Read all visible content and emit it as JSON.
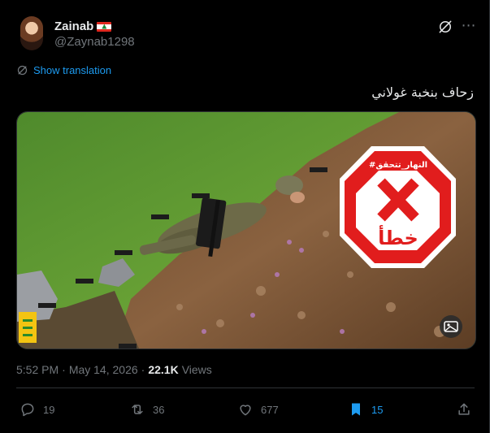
{
  "author": {
    "name": "Zainab",
    "handle": "@Zaynab1298",
    "flag_icon": "lebanon-flag-icon"
  },
  "translate": {
    "label": "Show translation"
  },
  "tweet": {
    "text": "زحاف بنخبة غولاني"
  },
  "media": {
    "stamp_tag": "#النهار_تتحقق",
    "stamp_word": "خطأ",
    "stamp_color": "#e11d1d",
    "alt_button_icon": "image-alt-icon"
  },
  "meta": {
    "time": "5:52 PM",
    "separator": "·",
    "date": "May 14, 2026",
    "views_count": "22.1K",
    "views_label": "Views"
  },
  "actions": {
    "replies": "19",
    "reposts": "36",
    "likes": "677",
    "bookmarks": "15"
  },
  "colors": {
    "accent": "#1d9bf0",
    "secondary_text": "#71767b",
    "border": "#2f3336"
  }
}
